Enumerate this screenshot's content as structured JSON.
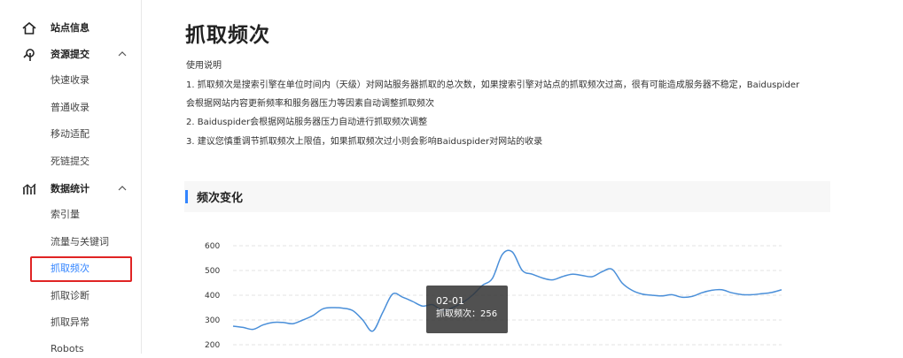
{
  "sidebar": {
    "site_info": "站点信息",
    "resource_submit": {
      "label": "资源提交",
      "items": [
        "快速收录",
        "普通收录",
        "移动适配",
        "死链提交"
      ]
    },
    "data_stats": {
      "label": "数据统计",
      "items": [
        "索引量",
        "流量与关键词",
        "抓取频次",
        "抓取诊断",
        "抓取异常",
        "Robots"
      ]
    },
    "active_item": "抓取频次"
  },
  "main": {
    "title": "抓取频次",
    "usage_title": "使用说明",
    "lines": [
      "1. 抓取频次是搜索引擎在单位时间内（天级）对网站服务器抓取的总次数，如果搜索引擎对站点的抓取频次过高，很有可能造成服务器不稳定，Baiduspider",
      "会根据网站内容更新频率和服务器压力等因素自动调整抓取频次",
      "2. Baiduspider会根据网站服务器压力自动进行抓取频次调整",
      "3. 建议您慎重调节抓取频次上限值，如果抓取频次过小则会影响Baiduspider对网站的收录"
    ],
    "section_title": "频次变化"
  },
  "tooltip": {
    "date": "02-01",
    "label": "抓取频次",
    "separator": "：",
    "value": "256"
  },
  "colors": {
    "accent": "#3385ff",
    "highlight_border": "#e02424",
    "line": "#4a8fd9"
  },
  "chart_data": {
    "type": "line",
    "ylim": [
      200,
      600
    ],
    "yticks": [
      600,
      500,
      400,
      300,
      200
    ],
    "grid": true,
    "series": [
      {
        "values": [
          275,
          270,
          262,
          280,
          290,
          290,
          285,
          300,
          318,
          345,
          350,
          348,
          338,
          300,
          255,
          330,
          405,
          392,
          375,
          356,
          362,
          338,
          350,
          370,
          400,
          440,
          468,
          565,
          575,
          500,
          485,
          470,
          462,
          475,
          485,
          480,
          475,
          495,
          505,
          450,
          420,
          405,
          400,
          397,
          402,
          392,
          395,
          410,
          420,
          422,
          410,
          403,
          402,
          406,
          411,
          422
        ]
      }
    ]
  }
}
